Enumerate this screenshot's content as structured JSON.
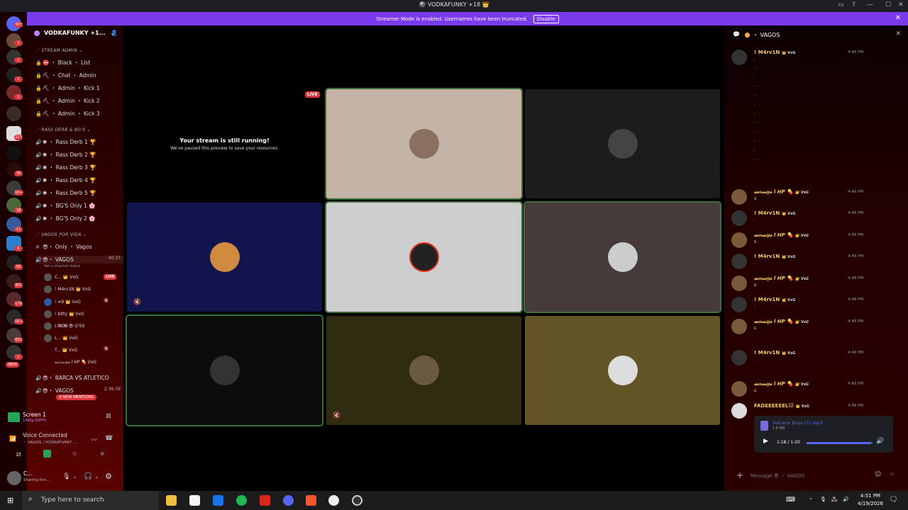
{
  "window": {
    "title": "🎱 VODKAFUNKY +18 👑"
  },
  "banner": {
    "text": "Streamer Mode is enabled. Usernames have been truncated.",
    "disable_label": "Disable"
  },
  "rail": {
    "badges": [
      "307",
      "1",
      "1",
      "2",
      "1",
      "217",
      "36",
      "1K+",
      "18",
      "11",
      "6",
      "50",
      "901",
      "179",
      "1K+",
      "652",
      "1"
    ],
    "new_label": "NEW"
  },
  "sidebar": {
    "guild_name": "VODKAFUNKY +1...",
    "categories": {
      "stream_admin": "STREAM ADMIN",
      "rass": "RASS DERB & BG'S",
      "vagos": "VAGOS POR VIDA"
    },
    "admin_channels": [
      "⛔ ・ Black ・ List",
      "⛏ ・ Chat ・ Admin",
      "⛏ ・ Admin ・ Kick 1",
      "⛏ ・ Admin ・ Kick 2",
      "⛏ ・ Admin ・ Kick 3"
    ],
    "rass_channels": [
      "Rass Derb 1 🏆",
      "Rass Derb 2 🏆",
      "Rass Derb 3 🏆",
      "Rass Derb 4 🏆",
      "Rass Derb 5 🏆",
      "BG'S Only 1 🌸",
      "BG'S Only 2 🌸"
    ],
    "vagos_text": "・ Only ・ Vagos",
    "vagos_voice": "・ VAGOS",
    "vagos_timer": "40:37",
    "channel_status": "Set a channel status",
    "voice_users": [
      {
        "name": "C...",
        "tag": "👑 VxG",
        "live": "LIVE"
      },
      {
        "name": "! M4rv1N",
        "tag": "👑 VxG"
      },
      {
        "name": "! ≠9",
        "tag": "👑 VxG"
      },
      {
        "name": "! bitty",
        "tag": "👑 VxG"
      },
      {
        "name": "L'𝐁𝐎𝐁 😎",
        "tag": "G'59"
      },
      {
        "name": "L...",
        "tag": "👑 VxG"
      },
      {
        "name": "T...",
        "tag": "👑 VxG"
      },
      {
        "name": "𝓂𝑒𝓇𝓃𝒾𝑔𝒶 l HP 💊",
        "tag": "VxG"
      }
    ],
    "barca": "・ BARCA VS ATLETICO",
    "vagos2": "・ VAGOS",
    "vagos2_timer": "2:36:39",
    "new_mentions": "4 NEW MENTIONS"
  },
  "screen_panel": {
    "title": "Screen 1",
    "quality": "1440p 60FPS"
  },
  "voice_panel": {
    "status": "Voice Connected",
    "channel": "・ VAGOS / VODKAFUNKY ..."
  },
  "user_panel": {
    "name": "C...",
    "status": "Sharing the..."
  },
  "stage": {
    "paused_title": "Your stream is still running!",
    "paused_sub": "We've paused this preview to save your resources.",
    "live_label": "LIVE"
  },
  "chat": {
    "channel": "・ VAGOS",
    "messages": [
      {
        "name": "! M4rv1N",
        "tag": "👑 VxG",
        "time": "4:48 PM",
        "body": ".",
        "color": "#f0c86a"
      },
      {
        "name": "𝓂𝑒𝓇𝓃𝒾𝑔𝒶 l HP 💊",
        "tag": "👑 VxG",
        "time": "4:48 PM",
        "body": "s",
        "color": "#f0c86a"
      },
      {
        "name": "! M4rv1N",
        "tag": "👑 VxG",
        "time": "4:48 PM",
        "body": ".",
        "color": "#f0c86a"
      },
      {
        "name": "𝓂𝑒𝓇𝓃𝒾𝑔𝒶 l HP 💊",
        "tag": "👑 VxG",
        "time": "4:48 PM",
        "body": "s",
        "color": "#f0c86a"
      },
      {
        "name": "! M4rv1N",
        "tag": "👑 VxG",
        "time": "4:48 PM",
        "body": ".",
        "color": "#f0c86a"
      },
      {
        "name": "𝓂𝑒𝓇𝓃𝒾𝑔𝒶 l HP 💊",
        "tag": "👑 VxG",
        "time": "4:48 PM",
        "body": "s",
        "color": "#f0c86a"
      },
      {
        "name": "! M4rv1N",
        "tag": "👑 VxG",
        "time": "4:48 PM",
        "body": ".",
        "color": "#f0c86a"
      },
      {
        "name": "𝓂𝑒𝓇𝓃𝒾𝑔𝒶 l HP 💊",
        "tag": "👑 VxG",
        "time": "4:48 PM",
        "body": "s",
        "color": "#f0c86a"
      },
      {
        "name": "! M4rv1N",
        "tag": "👑 VxG",
        "time": "4:48 PM",
        "body": ".",
        "color": "#f0c86a"
      },
      {
        "name": "𝓂𝑒𝓇𝓃𝒾𝑔𝒶 l HP 💊",
        "tag": "👑 VxG",
        "time": "4:48 PM",
        "body": "s",
        "color": "#f0c86a"
      },
      {
        "name": "FADEEEEEEL🐱",
        "tag": "👑 VxG",
        "time": "4:48 PM",
        "body": "",
        "color": "#f0c86a"
      }
    ],
    "attachment": {
      "name": "Volcano Boys (1).mp3",
      "size": "1.6 MB",
      "time": "1:18 / 1:20",
      "progress": 0.975
    },
    "input_placeholder": "Message 😎 ・ VAGOS"
  },
  "taskbar": {
    "search_placeholder": "Type here to search",
    "time": "4:51 PM",
    "date": "4/19/2026"
  }
}
